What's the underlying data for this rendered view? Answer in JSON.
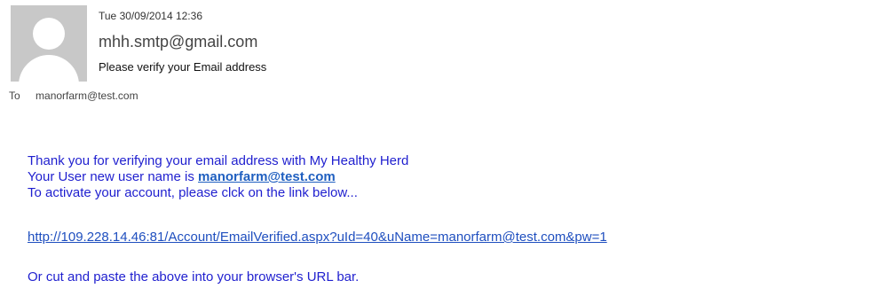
{
  "header": {
    "avatar_icon": "person-silhouette-icon",
    "date": "Tue 30/09/2014 12:36",
    "from": "mhh.smtp@gmail.com",
    "subject": "Please verify your Email address",
    "to_label": "To",
    "to_address": "manorfarm@test.com"
  },
  "message": {
    "line1": "Thank you for verifying your email address with My Healthy Herd",
    "line2_prefix": "Your User new user name is ",
    "line2_link": "manorfarm@test.com",
    "line3": "To activate your account, please clck on the link below...",
    "verify_link": "http://109.228.14.46:81/Account/EmailVerified.aspx?uId=40&uName=manorfarm@test.com&pw=1",
    "line5": "Or cut and paste the above into your browser's URL bar."
  },
  "colors": {
    "body_text": "#1f1fcf",
    "link": "#1f4fbf",
    "avatar_bg": "#c8c8c8"
  }
}
